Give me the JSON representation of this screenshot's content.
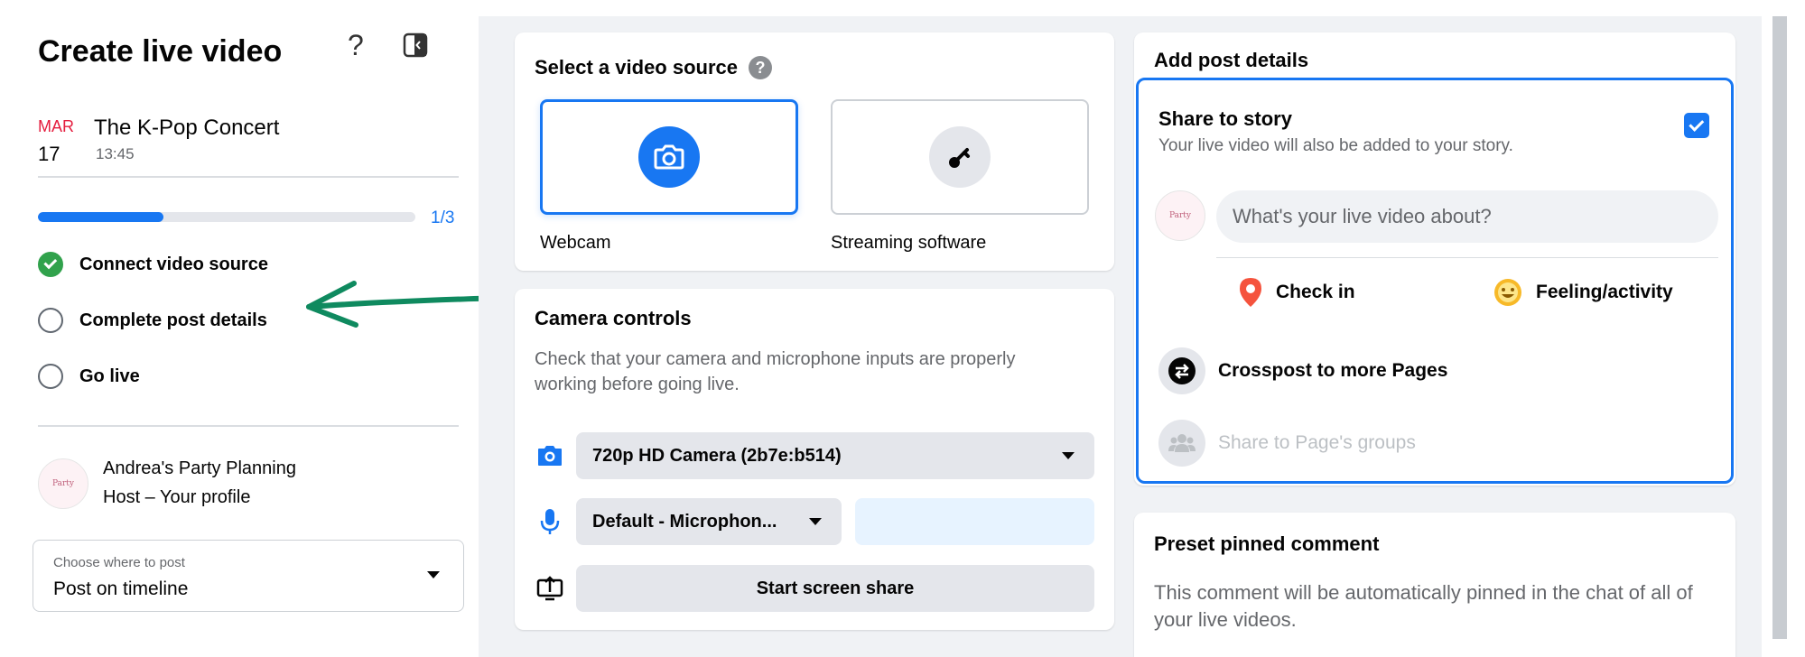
{
  "sidebar": {
    "title": "Create live video",
    "event": {
      "month": "MAR",
      "day": "17",
      "name": "The K-Pop Concert",
      "time": "13:45"
    },
    "progress": {
      "label": "1/3",
      "fraction": 0.333
    },
    "steps": [
      {
        "label": "Connect video source",
        "done": true
      },
      {
        "label": "Complete post details",
        "done": false
      },
      {
        "label": "Go live",
        "done": false
      }
    ],
    "profile": {
      "name": "Andrea's Party Planning",
      "role": "Host – Your profile",
      "avatar_text": "Party"
    },
    "post_where": {
      "label": "Choose where to post",
      "value": "Post on timeline"
    }
  },
  "video_source": {
    "title": "Select a video source",
    "options": [
      {
        "label": "Webcam",
        "icon": "camera-icon",
        "selected": true
      },
      {
        "label": "Streaming software",
        "icon": "key-icon",
        "selected": false
      }
    ]
  },
  "camera_controls": {
    "title": "Camera controls",
    "description": "Check that your camera and microphone inputs are properly working before going live.",
    "camera_value": "720p HD Camera (2b7e:b514)",
    "mic_value": "Default - Microphon...",
    "screen_share_label": "Start screen share"
  },
  "post_details": {
    "title": "Add post details",
    "share_story_title": "Share to story",
    "share_story_sub": "Your live video will also be added to your story.",
    "share_story_checked": true,
    "input_placeholder": "What's your live video about?",
    "check_in_label": "Check in",
    "feeling_label": "Feeling/activity",
    "crosspost_label": "Crosspost to more Pages",
    "groups_label": "Share to Page's groups"
  },
  "pinned_comment": {
    "title": "Preset pinned comment",
    "description": "This comment will be automatically pinned in the chat of all of your live videos."
  },
  "colors": {
    "accent": "#1877f2",
    "success": "#31a24c",
    "annotation_arrow": "#0f8a5f"
  }
}
